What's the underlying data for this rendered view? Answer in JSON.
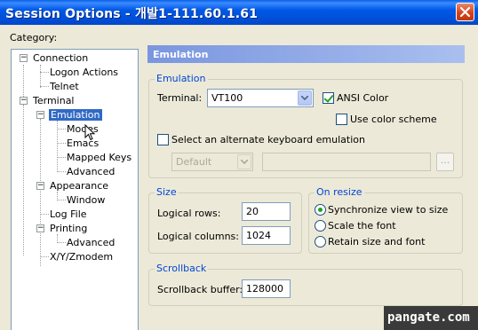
{
  "window": {
    "title": "Session Options - 개발1-111.60.1.61"
  },
  "category_label": "Category:",
  "tree": [
    {
      "label": "Connection",
      "expander": "−"
    },
    {
      "label": "Logon Actions"
    },
    {
      "label": "Telnet"
    },
    {
      "label": "Terminal",
      "expander": "−"
    },
    {
      "label": "Emulation",
      "expander": "−",
      "selected": true
    },
    {
      "label": "Modes"
    },
    {
      "label": "Emacs"
    },
    {
      "label": "Mapped Keys"
    },
    {
      "label": "Advanced"
    },
    {
      "label": "Appearance",
      "expander": "−"
    },
    {
      "label": "Window"
    },
    {
      "label": "Log File"
    },
    {
      "label": "Printing",
      "expander": "−"
    },
    {
      "label": "Advanced"
    },
    {
      "label": "X/Y/Zmodem"
    }
  ],
  "pane_title": "Emulation",
  "emulation_group": {
    "legend": "Emulation",
    "terminal_label": "Terminal:",
    "terminal_value": "VT100",
    "ansi_color_label": "ANSI Color",
    "ansi_color_checked": true,
    "use_color_scheme_label": "Use color scheme",
    "use_color_scheme_checked": false,
    "alt_keyboard_label": "Select an alternate keyboard emulation",
    "alt_keyboard_checked": false,
    "keyboard_select_value": "Default",
    "browse_label": "..."
  },
  "size_group": {
    "legend": "Size",
    "rows_label": "Logical rows:",
    "rows_value": "20",
    "columns_label": "Logical columns:",
    "columns_value": "1024"
  },
  "resize_group": {
    "legend": "On resize",
    "options": [
      "Synchronize view to size",
      "Scale the font",
      "Retain size and font"
    ],
    "selected_index": 0
  },
  "scrollback_group": {
    "legend": "Scrollback",
    "buffer_label": "Scrollback buffer:",
    "buffer_value": "128000"
  },
  "watermark": "pangate.com",
  "colors": {
    "title_bar": "#0054e3",
    "selection": "#316ac5",
    "group_legend": "#0046d5",
    "pane_header": "#7a96df"
  }
}
